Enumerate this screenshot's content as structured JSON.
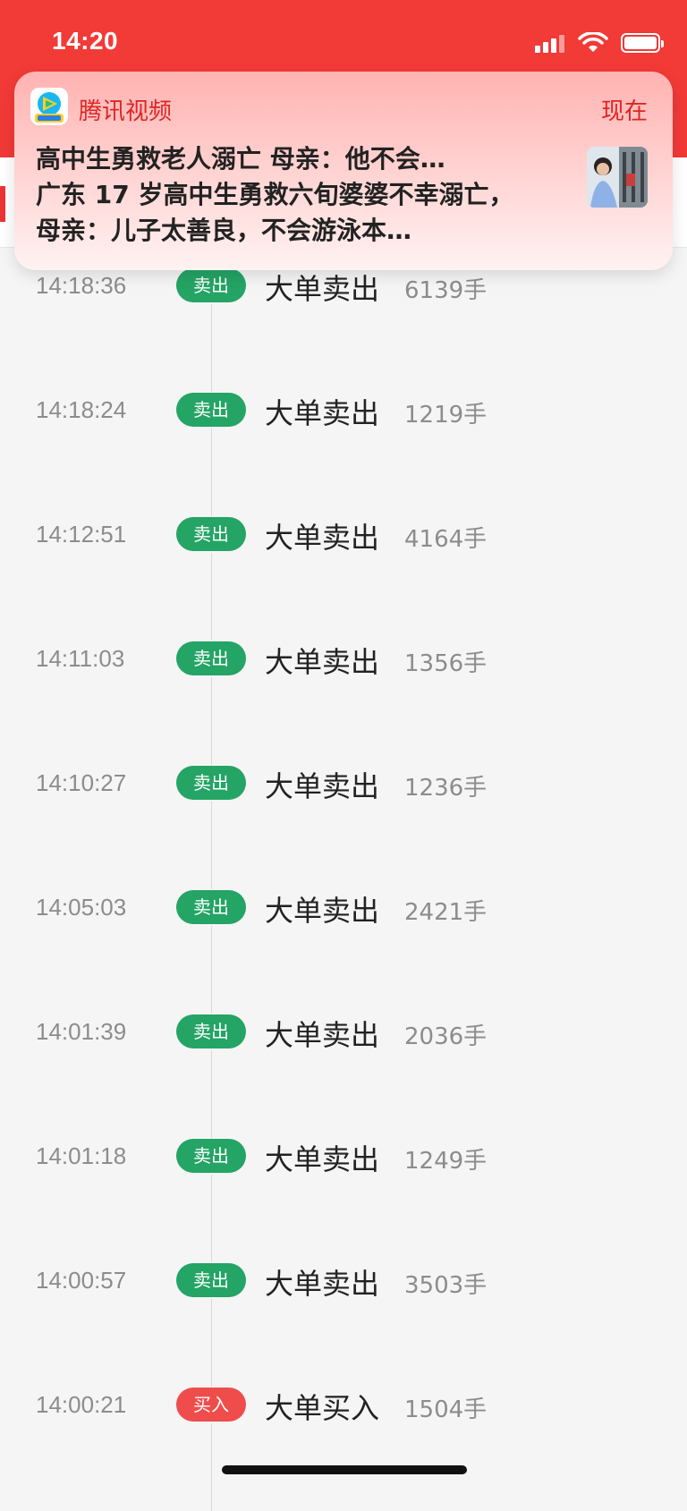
{
  "status_bar": {
    "time": "14:20"
  },
  "notification": {
    "app_name": "腾讯视频",
    "time": "现在",
    "title": "高中生勇救老人溺亡 母亲：他不会…",
    "body": "广东 17 岁高中生勇救六旬婆婆不幸溺亡，母亲：儿子太善良，不会游泳本…"
  },
  "trades": [
    {
      "time": "14:18:36",
      "badge": "卖出",
      "type": "sell",
      "label": "大单卖出",
      "qty": "6139手"
    },
    {
      "time": "14:18:24",
      "badge": "卖出",
      "type": "sell",
      "label": "大单卖出",
      "qty": "1219手"
    },
    {
      "time": "14:12:51",
      "badge": "卖出",
      "type": "sell",
      "label": "大单卖出",
      "qty": "4164手"
    },
    {
      "time": "14:11:03",
      "badge": "卖出",
      "type": "sell",
      "label": "大单卖出",
      "qty": "1356手"
    },
    {
      "time": "14:10:27",
      "badge": "卖出",
      "type": "sell",
      "label": "大单卖出",
      "qty": "1236手"
    },
    {
      "time": "14:05:03",
      "badge": "卖出",
      "type": "sell",
      "label": "大单卖出",
      "qty": "2421手"
    },
    {
      "time": "14:01:39",
      "badge": "卖出",
      "type": "sell",
      "label": "大单卖出",
      "qty": "2036手"
    },
    {
      "time": "14:01:18",
      "badge": "卖出",
      "type": "sell",
      "label": "大单卖出",
      "qty": "1249手"
    },
    {
      "time": "14:00:57",
      "badge": "卖出",
      "type": "sell",
      "label": "大单卖出",
      "qty": "3503手"
    },
    {
      "time": "14:00:21",
      "badge": "买入",
      "type": "buy",
      "label": "大单买入",
      "qty": "1504手"
    }
  ],
  "colors": {
    "header": "#f23a37",
    "sell": "#24a465",
    "buy": "#ef4d4b",
    "notification_accent": "#e02424"
  }
}
